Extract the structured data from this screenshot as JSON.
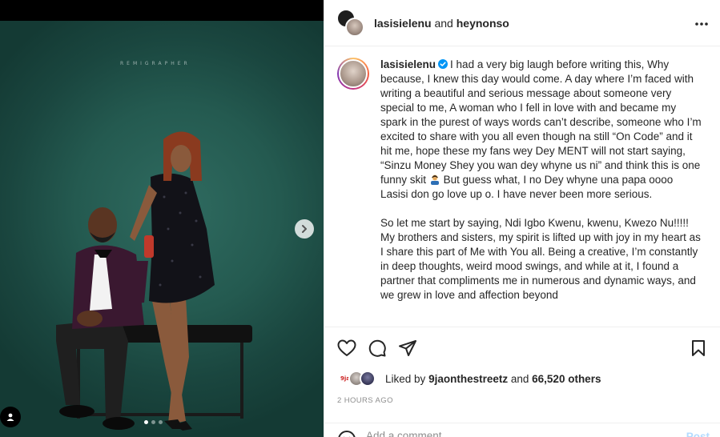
{
  "header": {
    "username_primary": "lasisielenu",
    "conjunction": "and",
    "username_collab": "heynonso",
    "more_icon": "more-horizontal-icon"
  },
  "media": {
    "watermark": "REMIGRAPHER",
    "carousel_count": 3,
    "carousel_active": 1
  },
  "caption": {
    "username": "lasisielenu",
    "verified": true,
    "paragraph1_a": "I had a very big laugh before writing this, Why because, I knew this day would come. A day where I’m faced with writing a beautiful and serious message about someone very special to me, A woman who I fell in love with and became my spark in the purest of ways words can’t describe, someone who I’m excited to share with you all even though na still “On Code” and it hit me, hope these my fans wey Dey MENT will not start saying, “Sinzu Money Shey you wan dey whyne us ni” and think this is one funny skit",
    "paragraph1_b": "But guess what, I no Dey whyne una papa oooo Lasisi don go love up o. I have never been more serious.",
    "paragraph2": "So let me start by saying, Ndi Igbo Kwenu, kwenu, Kwezo Nu!!!!! My brothers and sisters, my spirit is lifted up with joy in my heart as I share this part of Me with You all. Being a creative, I’m constantly in deep thoughts, weird mood swings, and while at it, I found a partner that compliments me in numerous and dynamic ways, and we grew in love and affection beyond"
  },
  "actions": {
    "like_icon": "heart-icon",
    "comment_icon": "comment-icon",
    "share_icon": "share-icon",
    "save_icon": "bookmark-icon"
  },
  "likes": {
    "prefix": "Liked by",
    "first_liker": "9jaonthestreetz",
    "and": "and",
    "others": "66,520 others",
    "avatar1_text": "9ja"
  },
  "time_ago": "2 HOURS AGO",
  "comment": {
    "placeholder": "Add a comment...",
    "post_label": "Post"
  },
  "colors": {
    "photo_bg": "#245a50",
    "verified_blue": "#0095f6",
    "post_disabled": "#b3dbff"
  }
}
